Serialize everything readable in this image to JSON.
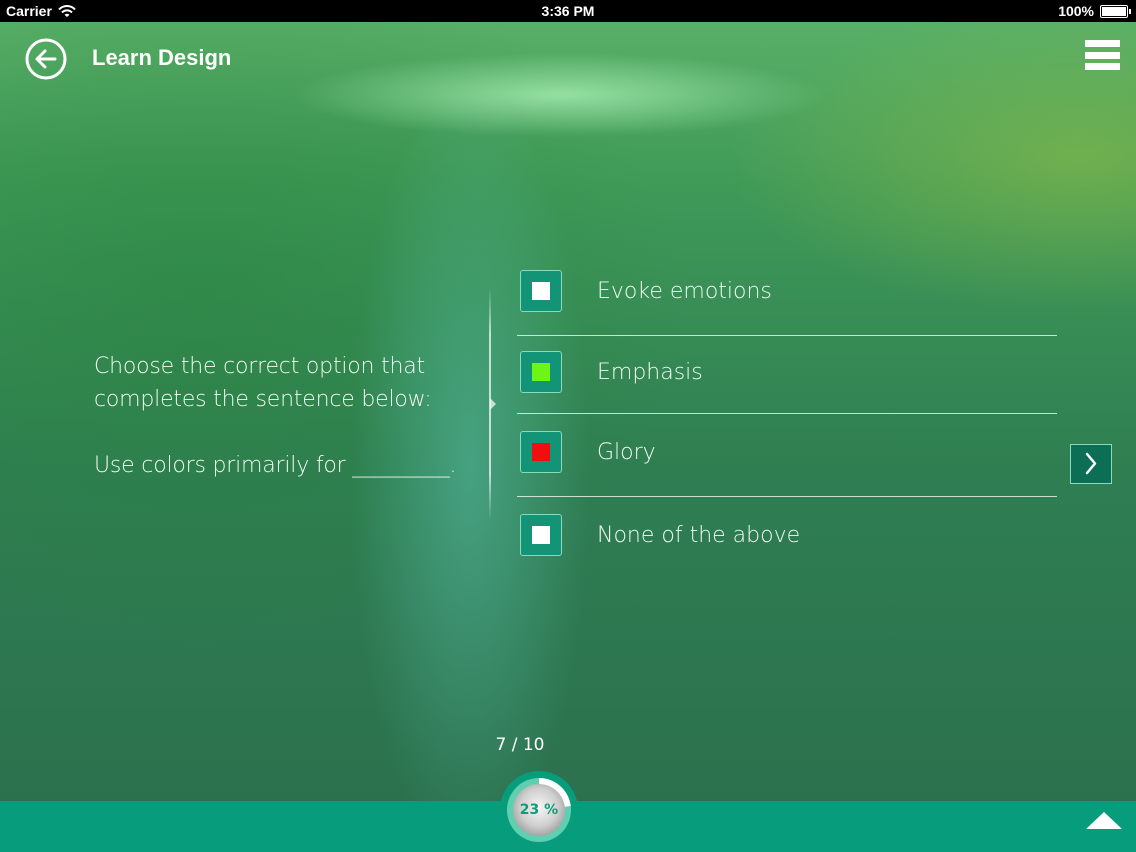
{
  "status_bar": {
    "carrier": "Carrier",
    "time": "3:36 PM",
    "battery": "100%"
  },
  "header": {
    "title": "Learn Design",
    "back_icon": "back-arrow-circle-icon",
    "menu_icon": "hamburger-menu-icon"
  },
  "question": {
    "prompt": "Choose the correct option that completes the sentence below:",
    "sentence": "Use colors primarily for _________."
  },
  "options": [
    {
      "label": "Evoke emotions",
      "mark_color": "#ffffff"
    },
    {
      "label": "Emphasis",
      "mark_color": "#6cf516"
    },
    {
      "label": "Glory",
      "mark_color": "#f20e0e"
    },
    {
      "label": "None of the above",
      "mark_color": "#ffffff"
    }
  ],
  "navigation": {
    "counter": "7 / 10",
    "next_icon": "chevron-right-icon",
    "up_icon": "triangle-up-icon"
  },
  "progress": {
    "label": "23 %",
    "fraction": 0.23
  },
  "colors": {
    "accent": "#079d7c",
    "option_box": "#149477"
  }
}
